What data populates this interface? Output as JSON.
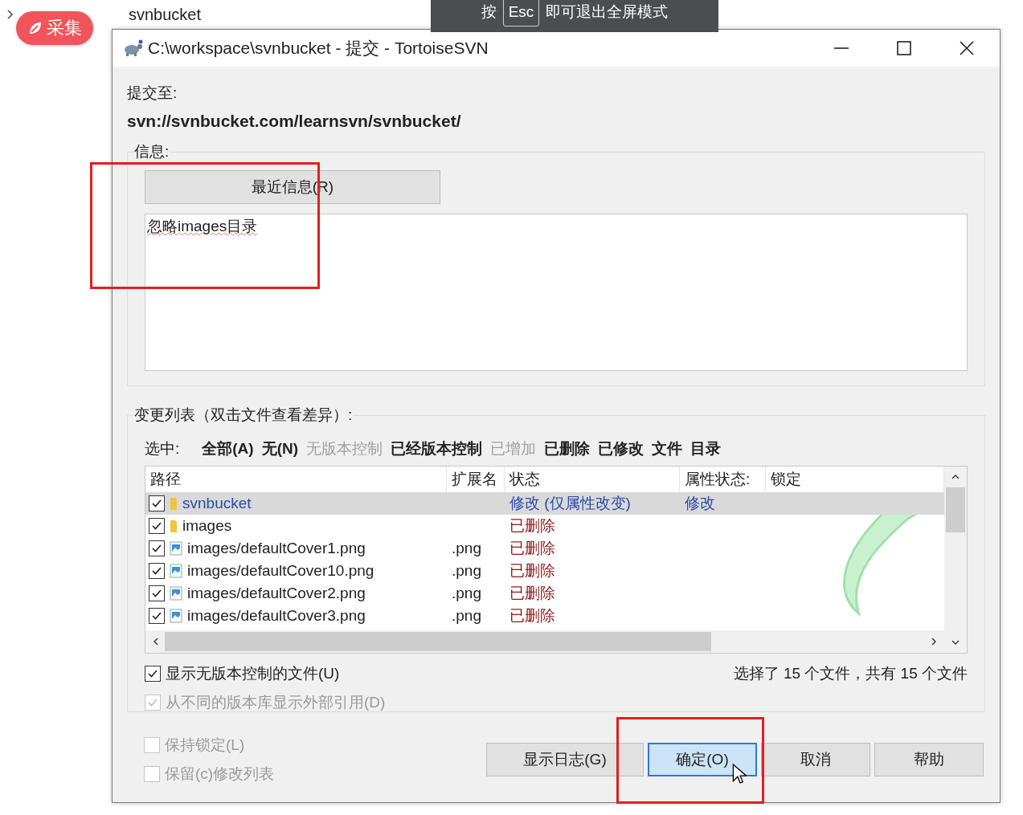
{
  "breadcrumb": [
    "svnbucket"
  ],
  "collect_badge": {
    "label": "采集"
  },
  "fullscreen_hint": {
    "prefix": "按",
    "key": "Esc",
    "text": "即可退出全屏模式"
  },
  "window": {
    "title": "C:\\workspace\\svnbucket - 提交 - TortoiseSVN"
  },
  "commit_to": {
    "label": "提交至:",
    "url": "svn://svnbucket.com/learnsvn/svnbucket/"
  },
  "message": {
    "group_label": "信息:",
    "recent_button": "最近信息(R)",
    "value": "忽略images目录"
  },
  "changes": {
    "group_label": "变更列表（双击文件查看差异）:",
    "select_label": "选中:",
    "filters": [
      {
        "label": "全部(A)",
        "disabled": false
      },
      {
        "label": "无(N)",
        "disabled": false
      },
      {
        "label": "无版本控制",
        "disabled": true
      },
      {
        "label": "已经版本控制",
        "disabled": false
      },
      {
        "label": "已增加",
        "disabled": true
      },
      {
        "label": "已删除",
        "disabled": false
      },
      {
        "label": "已修改",
        "disabled": false
      },
      {
        "label": "文件",
        "disabled": false
      },
      {
        "label": "目录",
        "disabled": false
      }
    ],
    "columns": [
      "路径",
      "扩展名",
      "状态",
      "属性状态:",
      "锁定"
    ],
    "rows": [
      {
        "checked": true,
        "selected": true,
        "kind": "folder",
        "color": "#2a4aa8",
        "path": "svnbucket",
        "ext": "",
        "status": "修改 (仅属性改变)",
        "prop_status": "修改"
      },
      {
        "checked": true,
        "selected": false,
        "kind": "folder",
        "color": "#8b1a1a",
        "path": "images",
        "ext": "",
        "status": "已删除",
        "prop_status": ""
      },
      {
        "checked": true,
        "selected": false,
        "kind": "image",
        "color": "#8b1a1a",
        "path": "images/defaultCover1.png",
        "ext": ".png",
        "status": "已删除",
        "prop_status": ""
      },
      {
        "checked": true,
        "selected": false,
        "kind": "image",
        "color": "#8b1a1a",
        "path": "images/defaultCover10.png",
        "ext": ".png",
        "status": "已删除",
        "prop_status": ""
      },
      {
        "checked": true,
        "selected": false,
        "kind": "image",
        "color": "#8b1a1a",
        "path": "images/defaultCover2.png",
        "ext": ".png",
        "status": "已删除",
        "prop_status": ""
      },
      {
        "checked": true,
        "selected": false,
        "kind": "image",
        "color": "#8b1a1a",
        "path": "images/defaultCover3.png",
        "ext": ".png",
        "status": "已删除",
        "prop_status": ""
      }
    ],
    "options": [
      {
        "label": "显示无版本控制的文件(U)",
        "checked": true,
        "disabled": false
      },
      {
        "label": "从不同的版本库显示外部引用(D)",
        "checked": true,
        "disabled": true
      }
    ],
    "summary": "选择了 15 个文件，共有 15 个文件"
  },
  "bottom_options": [
    {
      "label": "保持锁定(L)",
      "checked": false,
      "disabled": true
    },
    {
      "label": "保留(c)修改列表",
      "checked": false,
      "disabled": true
    }
  ],
  "buttons": [
    {
      "label": "显示日志(G)",
      "default": false
    },
    {
      "label": "确定(O)",
      "default": true
    },
    {
      "label": "取消",
      "default": false
    },
    {
      "label": "帮助",
      "default": false
    }
  ]
}
